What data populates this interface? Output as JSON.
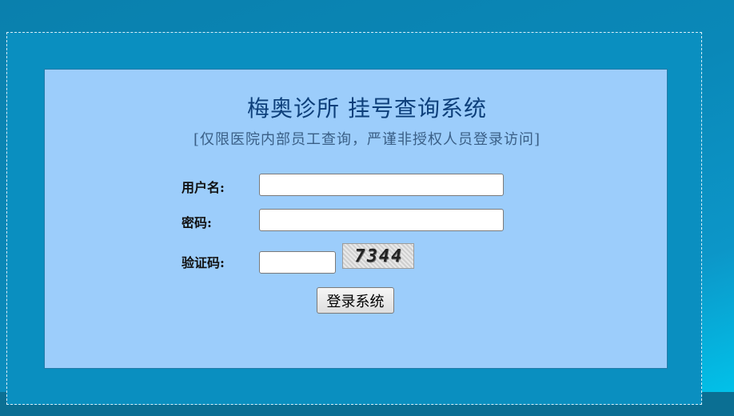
{
  "header": {
    "title": "梅奥诊所 挂号查询系统",
    "subtitle": "[仅限医院内部员工查询，严谨非授权人员登录访问]"
  },
  "form": {
    "username_label": "用户名:",
    "username_value": "",
    "password_label": "密码:",
    "password_value": "",
    "captcha_label": "验证码:",
    "captcha_value": "",
    "captcha_image_text": "7344",
    "login_button": "登录系统"
  },
  "colors": {
    "background": "#0a88b8",
    "panel": "#9ccdfb",
    "title": "#0d3f7a"
  }
}
